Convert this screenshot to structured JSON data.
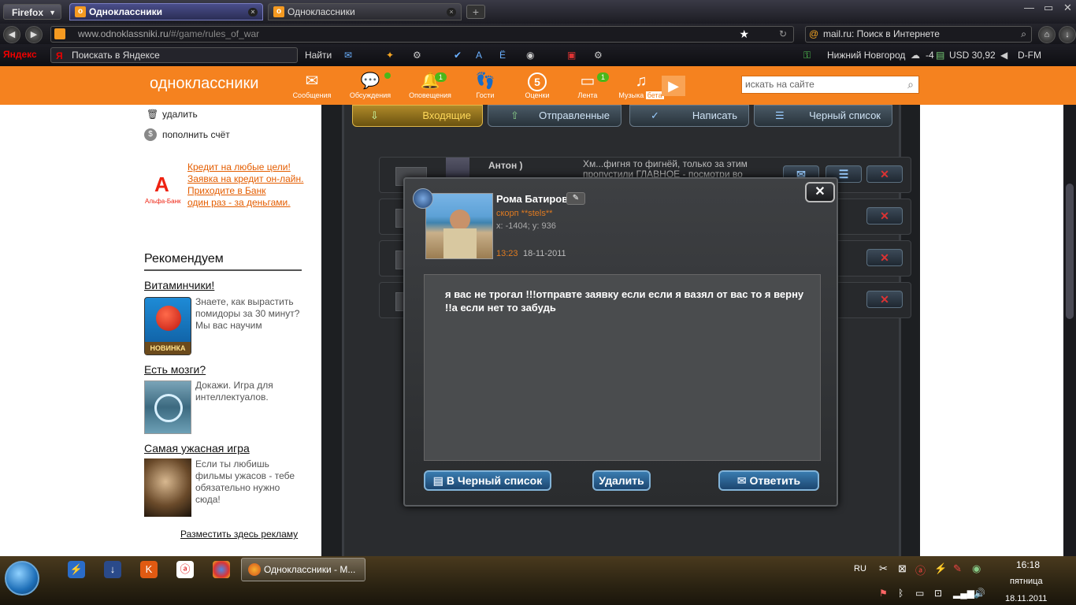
{
  "browser": {
    "menu_label": "Firefox",
    "tabs": [
      {
        "title": "Одноклассники",
        "active": true
      },
      {
        "title": "Одноклассники",
        "active": false
      }
    ],
    "url_host": "www.odnoklassniki.ru",
    "url_path": "/#/game/rules_of_war",
    "search_engine_text": "mail.ru: Поиск в Интернете"
  },
  "yandex_bar": {
    "logo": "Яндекс",
    "search_placeholder": "Поискать в Яндексе",
    "find_label": "Найти",
    "city": "Нижний Новгород",
    "temperature": "-4",
    "currency": "USD 30,92",
    "radio": "D-FM"
  },
  "site": {
    "logo": "одноклассники",
    "menu": [
      {
        "label": "Сообщения",
        "badge": ""
      },
      {
        "label": "Обсуждения",
        "badge": ""
      },
      {
        "label": "Оповещения",
        "badge": "1"
      },
      {
        "label": "Гости",
        "badge": ""
      },
      {
        "label": "Оценки",
        "badge": "5"
      },
      {
        "label": "Лента",
        "badge": "1"
      },
      {
        "label": "Музыка",
        "badge": "бета"
      }
    ],
    "search_placeholder": "искать на сайте"
  },
  "left": {
    "delete_label": "удалить",
    "topup_label": "пополнить счёт",
    "ad_brand": "Альфа-Банк",
    "ad_lines": [
      "Кредит на любые цели!",
      "Заявка на кредит он-лайн.",
      "Приходите в Банк",
      "один раз - за деньгами."
    ],
    "recommend_title": "Рекомендуем",
    "items": [
      {
        "title": "Витаминчики!",
        "text": "Знаете, как вырастить помидоры за 30 минут? Мы вас научим",
        "badge": "НОВИНКА"
      },
      {
        "title": "Есть мозги?",
        "text": "Докажи. Игра для интеллектуалов."
      },
      {
        "title": "Самая ужасная игра",
        "text": "Если ты любишь фильмы ужасов - тебе обязательно нужно сюда!"
      }
    ],
    "place_ad": "Разместить здесь рекламу"
  },
  "game": {
    "tabs": [
      "Входящие",
      "Отправленные",
      "Написать",
      "Черный список"
    ],
    "first_row_sender": "Антон )",
    "first_row_preview": "Хм...фигня то фигнёй, только за этим пропустили ГЛАВНОЕ - посмотри во"
  },
  "dialog": {
    "user_name": "Рома Батиров",
    "clan": "скорп **stels**",
    "coords": "x: -1404; y: 936",
    "time": "13:23",
    "date": "18-11-2011",
    "message": "я вас не трогал !!!отправте заявку если если я вазял от вас то я верну !!а если нет то забудь",
    "blacklist_btn": "В Черный список",
    "delete_btn": "Удалить",
    "reply_btn": "Ответить"
  },
  "taskbar": {
    "task_title": "Одноклассники - M...",
    "lang": "RU",
    "time": "16:18",
    "day": "пятница",
    "date": "18.11.2011"
  }
}
